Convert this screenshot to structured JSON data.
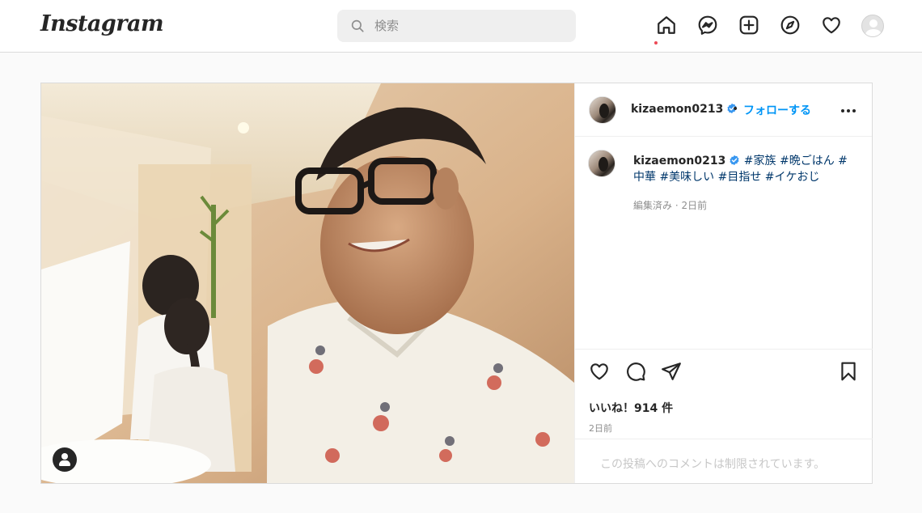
{
  "header": {
    "logo": "Instagram",
    "search_placeholder": "検索"
  },
  "post": {
    "author": "kizaemon0213",
    "follow_label": "フォローする",
    "separator": "•",
    "caption_tags": "#家族 #晩ごはん # 中華 #美味しい #目指せ #イケおじ",
    "edited_meta": "編集済み · 2日前",
    "likes_label": "いいね！914 件",
    "posted_date": "2日前",
    "comments_notice": "この投稿へのコメントは制限されています。"
  },
  "colors": {
    "accent": "#0095f6",
    "notification": "#ed4956",
    "verified": "#3897f0"
  },
  "icons": [
    "search-icon",
    "home-icon",
    "messenger-icon",
    "new-post-icon",
    "explore-icon",
    "activity-heart-icon",
    "like-icon",
    "comment-icon",
    "share-icon",
    "save-icon",
    "verified-badge-icon",
    "more-options-icon",
    "tagged-user-icon"
  ]
}
